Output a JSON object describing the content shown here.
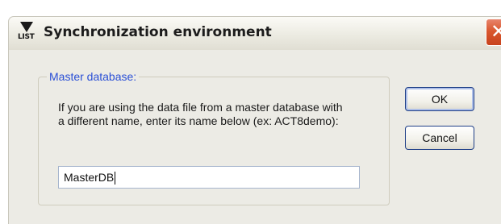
{
  "window": {
    "title": "Synchronization environment",
    "icon_label": "LIST",
    "close_glyph": "✕"
  },
  "group": {
    "legend": "Master database:",
    "description": "If you are using the data file from a master database with a different name, enter its name below (ex: ACT8demo):"
  },
  "field": {
    "value": "MasterDB"
  },
  "buttons": {
    "ok_label": "OK",
    "cancel_label": "Cancel"
  },
  "colors": {
    "legend_text": "#2a4fd6",
    "close_button": "#d9582f",
    "dialog_face": "#ecebe5",
    "button_border": "#1f3f87"
  },
  "icons": {
    "app": "list-app-icon",
    "close": "close-icon"
  }
}
